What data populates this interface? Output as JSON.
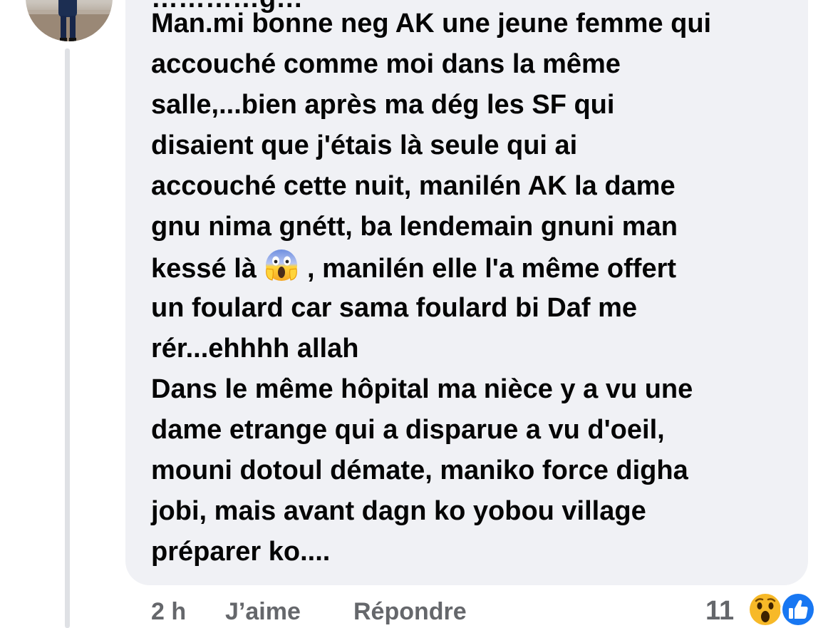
{
  "comment": {
    "cut_line": "…………g…",
    "lines": [
      {
        "text": "Man.mi bonne neg AK une jeune femme qui"
      },
      {
        "text": "accouché comme moi dans la même"
      },
      {
        "text": "salle,...bien après ma dég les  SF qui"
      },
      {
        "text": "disaient que j'étais là seule qui ai"
      },
      {
        "text": "accouché cette nuit, manilén AK la dame"
      },
      {
        "text": "gnu nima gnétt, ba lendemain gnuni man"
      },
      {
        "before": "kessé là ",
        "emoji": "face-screaming-in-fear-emoji",
        "after": " , manilén elle l'a même offert"
      },
      {
        "text": "un foulard car sama foulard bi Daf me"
      },
      {
        "text": "rér...ehhhh allah"
      },
      {
        "text": "Dans le même hôpital ma nièce y a  vu une"
      },
      {
        "text": "dame etrange qui a disparue a vu d'oeil,"
      },
      {
        "text": "mouni dotoul démate, maniko force digha"
      },
      {
        "text": "jobi, mais avant dagn ko yobou village"
      },
      {
        "text": "préparer ko...."
      }
    ]
  },
  "actions": {
    "timestamp": "2 h",
    "like_label": "J’aime",
    "reply_label": "Répondre"
  },
  "reactions": {
    "count": "11",
    "icons": [
      "wow-reaction-icon",
      "like-reaction-icon"
    ]
  },
  "colors": {
    "bubble": "#f0f1f5",
    "text": "#050505",
    "meta": "#65676b",
    "thread_line": "#dfe1e5",
    "like_blue": "#1877f2",
    "wow_yellow": "#f7b928"
  }
}
